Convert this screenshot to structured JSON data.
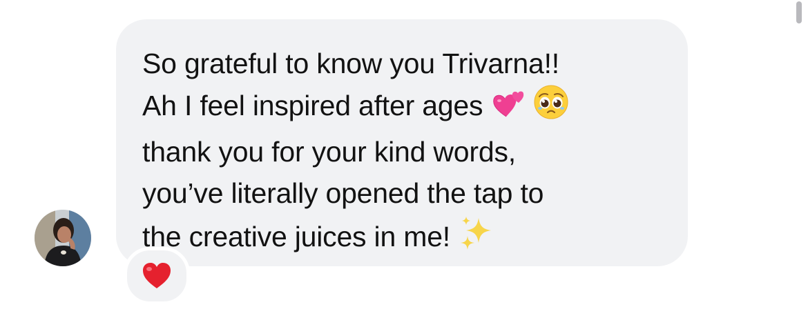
{
  "conversation": {
    "message": {
      "lines": [
        "So grateful to know you Trivarna!!",
        "Ah I feel inspired after ages",
        "thank you for your kind words,",
        "you’ve literally opened the tap to",
        "the creative juices in me!"
      ],
      "emojis": [
        "two-hearts-icon",
        "pleading-face-icon",
        "sparkles-icon"
      ]
    },
    "reaction": {
      "icon": "red-heart-icon",
      "color": "#e5212e"
    },
    "sender_avatar": "avatar"
  },
  "colors": {
    "bubble_background": "#f1f2f4",
    "text": "#121212",
    "background": "#ffffff"
  }
}
